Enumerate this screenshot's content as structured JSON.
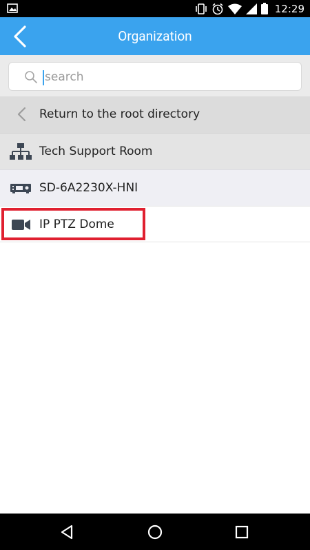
{
  "status_bar": {
    "time": "12:29",
    "icons": [
      "image-icon",
      "vibrate-icon",
      "alarm-icon",
      "wifi-icon",
      "signal-icon",
      "battery-icon"
    ]
  },
  "app_bar": {
    "title": "Organization",
    "accent_color": "#3aa3ee"
  },
  "search": {
    "placeholder": "search",
    "value": ""
  },
  "tree": {
    "root_label": "Return to the root directory",
    "items": [
      {
        "label": "Tech Support Room",
        "icon": "organization-icon"
      },
      {
        "label": "SD-6A2230X-HNI",
        "icon": "dvr-icon"
      },
      {
        "label": "IP PTZ Dome",
        "icon": "camera-icon"
      }
    ]
  },
  "highlight_color": "#e02030",
  "nav_bar": {
    "icons": [
      "back-triangle-icon",
      "home-circle-icon",
      "recents-square-icon"
    ]
  }
}
